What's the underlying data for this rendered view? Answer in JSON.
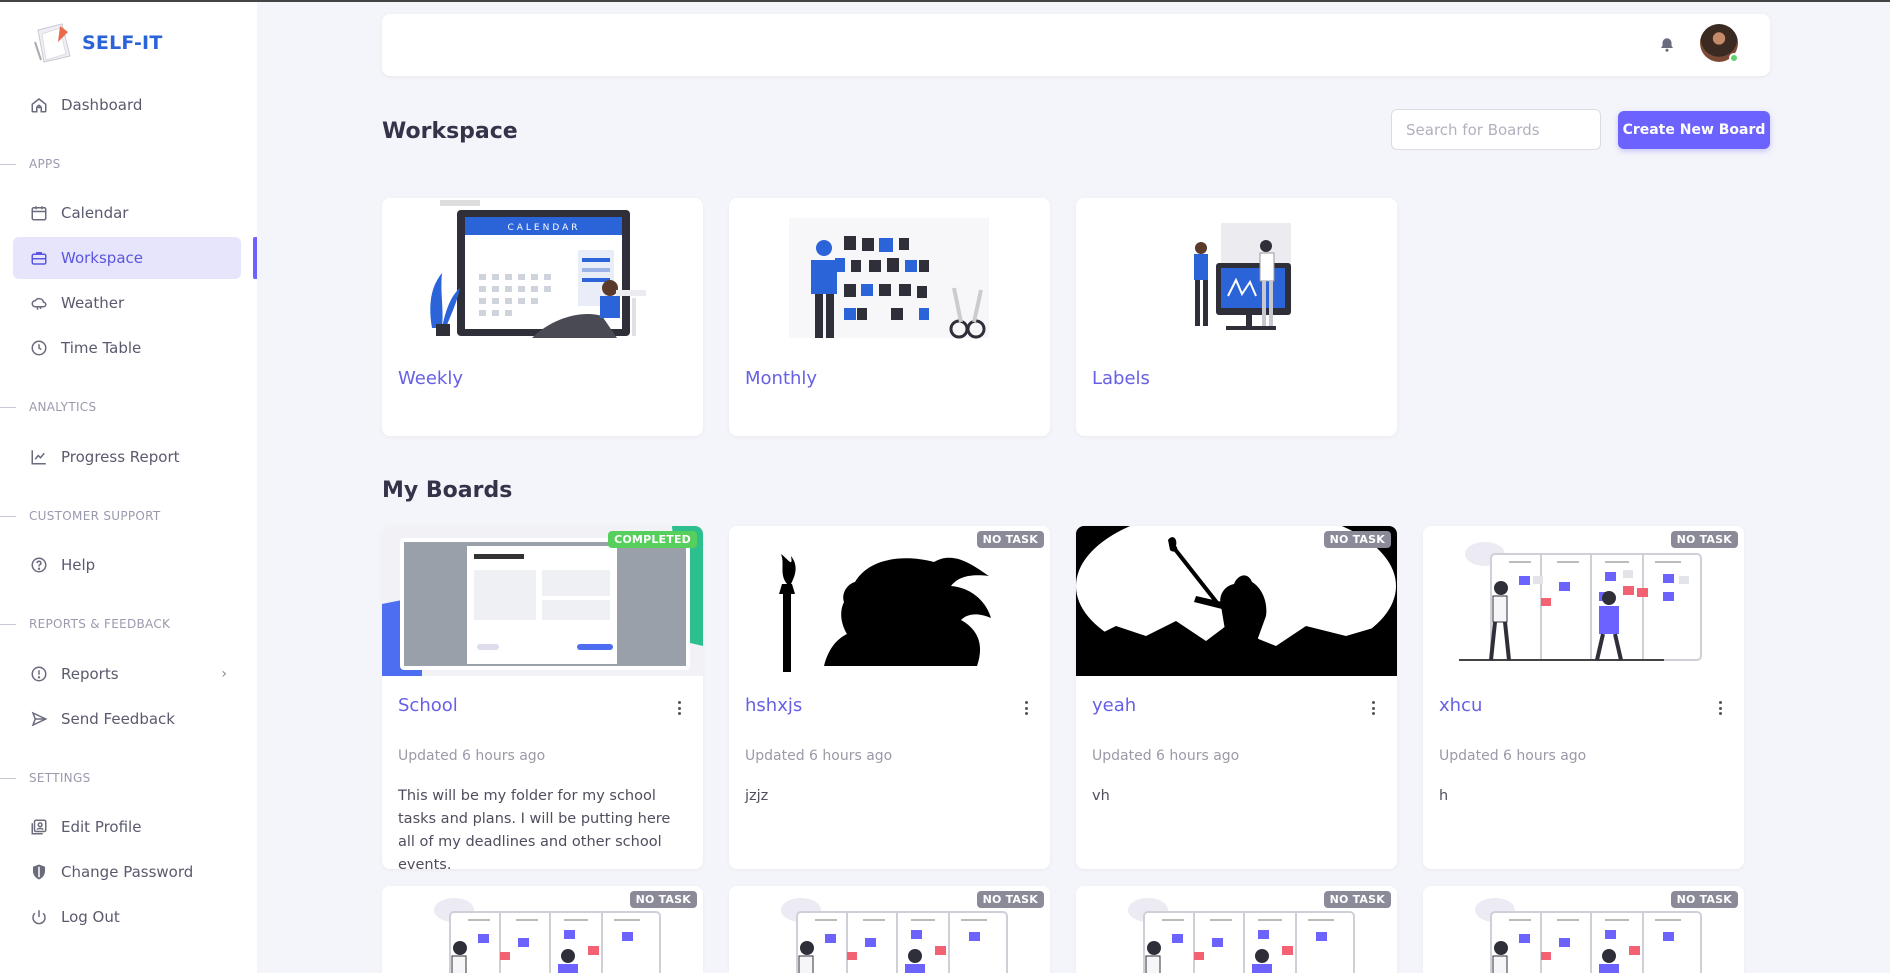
{
  "app": {
    "name": "SELF-IT"
  },
  "colors": {
    "accent": "#6c63ff",
    "link": "#6660e6",
    "completed": "#57cf5c",
    "notask": "#8a8a99"
  },
  "sidebar": {
    "dashboard": "Dashboard",
    "sections": {
      "apps": "APPS",
      "analytics": "ANALYTICS",
      "support": "CUSTOMER SUPPORT",
      "reports": "REPORTS & FEEDBACK",
      "settings": "SETTINGS"
    },
    "items": {
      "calendar": "Calendar",
      "workspace": "Workspace",
      "weather": "Weather",
      "timetable": "Time Table",
      "progress": "Progress Report",
      "help": "Help",
      "reports": "Reports",
      "feedback": "Send Feedback",
      "edit_profile": "Edit Profile",
      "change_password": "Change Password",
      "logout": "Log Out"
    }
  },
  "workspace": {
    "title": "Workspace",
    "search_placeholder": "Search for Boards",
    "create_label": "Create New Board",
    "cards": [
      "Weekly",
      "Monthly",
      "Labels"
    ],
    "calendar_word": "CALENDAR"
  },
  "boards": {
    "title": "My Boards",
    "items": [
      {
        "name": "School",
        "status": "COMPLETED",
        "updated": "Updated 6 hours ago",
        "desc": "This will be my folder for my school tasks and plans. I will be putting here all of my deadlines and other school events."
      },
      {
        "name": "hshxjs",
        "status": "NO TASK",
        "updated": "Updated 6 hours ago",
        "desc": "jzjz"
      },
      {
        "name": "yeah",
        "status": "NO TASK",
        "updated": "Updated 6 hours ago",
        "desc": "vh"
      },
      {
        "name": "xhcu",
        "status": "NO TASK",
        "updated": "Updated 6 hours ago",
        "desc": "h"
      }
    ],
    "row2_status": "NO TASK"
  }
}
